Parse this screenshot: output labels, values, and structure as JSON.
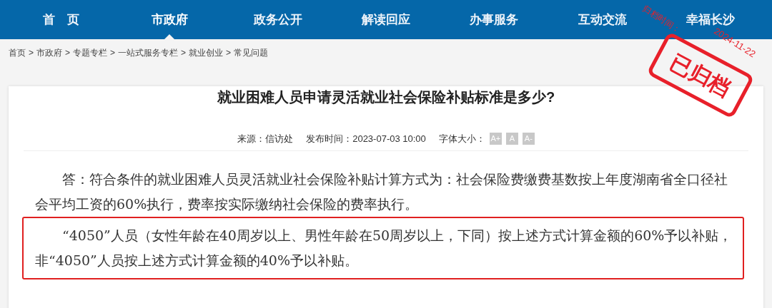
{
  "nav": [
    {
      "label": "首　页",
      "selected": false
    },
    {
      "label": "市政府",
      "selected": true
    },
    {
      "label": "政务公开",
      "selected": false
    },
    {
      "label": "解读回应",
      "selected": false
    },
    {
      "label": "办事服务",
      "selected": false
    },
    {
      "label": "互动交流",
      "selected": false
    },
    {
      "label": "幸福长沙",
      "selected": false
    }
  ],
  "breadcrumb": [
    "首页",
    "市政府",
    "专题专栏",
    "一站式服务专栏",
    "就业创业",
    "常见问题"
  ],
  "breadcrumb_separator": ">",
  "article": {
    "title": "就业困难人员申请灵活就业社会保险补贴标准是多少?",
    "source": "来源：信访处",
    "published": "发布时间：2023-07-03 10:00",
    "font_size_label": "字体大小：",
    "font_buttons": [
      "A+",
      "A",
      "A-"
    ],
    "paragraphs": [
      {
        "text": "答：符合条件的就业困难人员灵活就业社会保险补贴计算方式为：社会保险费缴费基数按上年度湖南省全口径社会平均工资的60%执行，费率按实际缴纳社会保险的费率执行。",
        "highlighted": false
      },
      {
        "text": "“4050”人员（女性年龄在40周岁以上、男性年龄在50周岁以上，下同）按上述方式计算金额的60%予以补贴，非“4050”人员按上述方式计算金额的40%予以补贴。",
        "highlighted": true
      }
    ]
  },
  "stamp": {
    "label": "已归档",
    "date_label": "归档时间：",
    "date": "2024-11-22"
  }
}
